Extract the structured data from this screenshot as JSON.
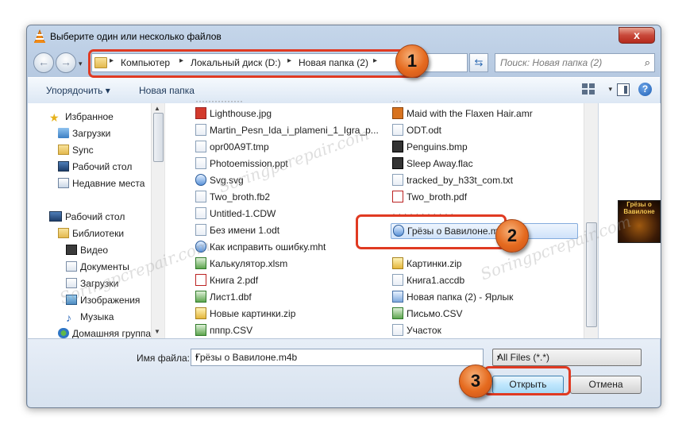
{
  "window": {
    "title": "Выберите один или несколько файлов",
    "close_glyph": "x"
  },
  "nav_buttons": {
    "back": "←",
    "forward": "→",
    "dropdown": "▾"
  },
  "address": {
    "segments": [
      "Компьютер",
      "Локальный диск (D:)",
      "Новая папка (2)"
    ],
    "separator": "▸",
    "refresh_glyph": "⇆"
  },
  "search": {
    "placeholder": "Поиск: Новая папка (2)",
    "icon": "search-icon"
  },
  "toolbar": {
    "organize": "Упорядочить",
    "organize_arrow": "▾",
    "new_folder": "Новая папка",
    "view_arrow": "▾",
    "help": "?"
  },
  "sidebar": {
    "favorites": {
      "label": "Избранное",
      "items": [
        "Загрузки",
        "Sync",
        "Рабочий стол",
        "Недавние места"
      ]
    },
    "desktop": {
      "label": "Рабочий стол",
      "libraries": "Библиотеки",
      "library_items": [
        "Видео",
        "Документы",
        "Загрузки",
        "Изображения",
        "Музыка"
      ],
      "homegroup": "Домашняя группа"
    }
  },
  "files": {
    "col1": [
      "Lighthouse.jpg",
      "Martin_Pesn_Ida_i_plameni_1_Igra_p...",
      "opr00A9T.tmp",
      "Photoemission.ppt",
      "Svg.svg",
      "Two_broth.fb2",
      "Untitled-1.CDW",
      "Без имени 1.odt",
      "Как исправить ошибку.mht",
      "Калькулятор.xlsm",
      "Книга 2.pdf",
      "Лист1.dbf",
      "Новые картинки.zip",
      "пппр.CSV"
    ],
    "col2": [
      "Maid with the Flaxen Hair.amr",
      "ODT.odt",
      "Penguins.bmp",
      "Sleep Away.flac",
      "tracked_by_h33t_com.txt",
      "Two_broth.pdf",
      "Грёзы о Вавилоне.m4b",
      "Картинки.zip",
      "Книга1.accdb",
      "Новая папка (2) - Ярлык",
      "Письмо.CSV",
      "Участок"
    ],
    "selected": "Грёзы о Вавилоне.m4b"
  },
  "preview": {
    "cover_text": "Грёзы о Вавилоне"
  },
  "bottom": {
    "filename_label": "Имя файла:",
    "filename_value": "Грёзы о Вавилоне.m4b",
    "filter": "All Files (*.*)",
    "dropdown_glyph": "▾",
    "open": "Открыть",
    "cancel": "Отмена"
  },
  "badges": [
    "1",
    "2",
    "3"
  ],
  "watermark": "Soringpcrepair.com",
  "colors": {
    "highlight": "#e03a22",
    "badge": "#e56a1e",
    "link": "#1e395b"
  }
}
